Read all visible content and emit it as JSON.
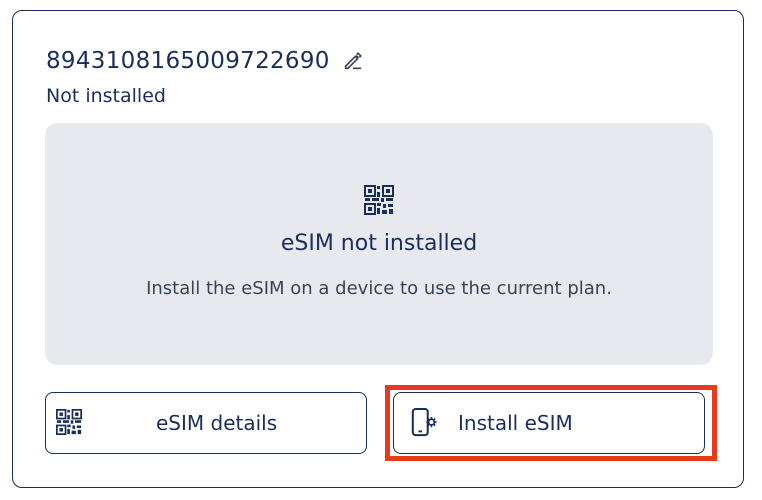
{
  "esim": {
    "iccid": "8943108165009722690",
    "status": "Not installed"
  },
  "panel": {
    "title": "eSIM not installed",
    "description": "Install the eSIM on a device to use the current plan."
  },
  "buttons": {
    "details_label": "eSIM details",
    "install_label": "Install eSIM"
  },
  "icons": {
    "edit": "pencil-edit-icon",
    "qr": "qr-code-icon",
    "device": "phone-settings-icon"
  },
  "colors": {
    "primary_text": "#1a2e5c",
    "panel_bg": "#e7e9ee",
    "highlight": "#e8391f"
  }
}
